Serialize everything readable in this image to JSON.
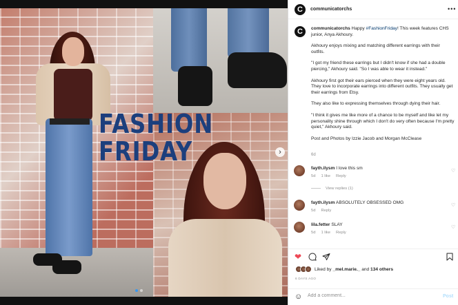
{
  "post": {
    "headline_line1": "FASHION",
    "headline_line2": "FRIDAY",
    "next_arrow": "›"
  },
  "header": {
    "avatar_letter": "C",
    "username": "communicatorchs",
    "more": "•••"
  },
  "caption": {
    "username": "communicatorchs",
    "text_before_tag": " Happy ",
    "hashtag": "#FashionFriday",
    "text_after_tag": "! This week features CHS junior, Anya Akhoury.",
    "paragraphs": [
      "Akhoury enjoys mixing and matching different earrings with their outfits.",
      "\"I got my friend these earrings but I didn't know if she had a double piercing,\" Akhoury said. \"So I was able to wear it instead.\"",
      "Akhoury first got their ears pierced when they were eight years old. They love to incorporate earrings into different outfits. They usually get their earrings from Etsy.",
      "They also like to expressing themselves through dying their hair.",
      "\"I think it gives me like more of a chance to be myself and like let my personality shine through which I don't do very often because I'm pretty quiet,\" Akhoury said.",
      "Post and Photos by Izzie Jacob and Morgan McClease"
    ],
    "age": "6d"
  },
  "comments": [
    {
      "user": "fayth.ilysm",
      "text": "I love this sm",
      "age": "5d",
      "likes": "1 like",
      "reply": "Reply"
    },
    {
      "user": "fayth.ilysm",
      "text": "ABSOLUTELY OBSESSED OMG",
      "age": "5d",
      "likes": "",
      "reply": "Reply"
    },
    {
      "user": "lila.fetter",
      "text": "SLAY",
      "age": "5d",
      "likes": "1 like",
      "reply": "Reply"
    }
  ],
  "view_replies": "View replies (1)",
  "likes": {
    "prefix": "Liked by ",
    "user": "_mel.marie._",
    "middle": " and ",
    "others": "134 others"
  },
  "time_ago": "6 DAYS AGO",
  "add_comment": {
    "placeholder": "Add a comment...",
    "post_label": "Post"
  },
  "icons": {
    "heart": "heart-icon",
    "comment": "comment-icon",
    "share": "share-icon",
    "bookmark": "bookmark-icon",
    "emoji": "emoji-icon"
  },
  "colors": {
    "headline": "#1c3f7d",
    "liked_heart": "#ed4956",
    "link": "#00376b",
    "post_disabled": "#b2dffc"
  }
}
